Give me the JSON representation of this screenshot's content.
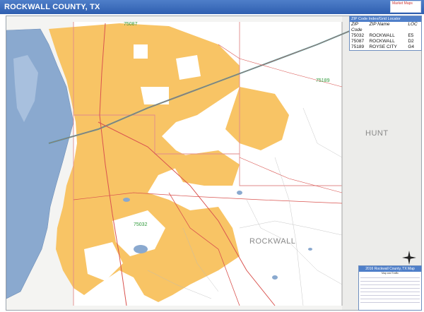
{
  "header": {
    "title": "ROCKWALL COUNTY, TX",
    "brand": "Market Maps"
  },
  "zip_table": {
    "header": "ZIP Code Index/Grid Locator",
    "columns": [
      "ZIP Code",
      "ZIP Name",
      "LOC"
    ],
    "rows": [
      {
        "zip": "75032",
        "name": "ROCKWALL",
        "loc": "E5"
      },
      {
        "zip": "75087",
        "name": "ROCKWALL",
        "loc": "D2"
      },
      {
        "zip": "75189",
        "name": "ROYSE CITY",
        "loc": "G4"
      }
    ]
  },
  "map_labels": {
    "county_hunt": "HUNT",
    "county_rockwall": "ROCKWALL",
    "zip_75087": "75087",
    "zip_75189": "75189",
    "zip_75032": "75032"
  },
  "legend": {
    "title": "2016 Rockwall County, TX Map",
    "subtitle": "Map and Traffic"
  },
  "colors": {
    "title_bar": "#3b6cbf",
    "urban": "#f8c465",
    "water": "#8aa9cf",
    "road_major": "#d9534f",
    "highway": "#4aa0a0",
    "zip_boundary": "#e08a8a"
  }
}
